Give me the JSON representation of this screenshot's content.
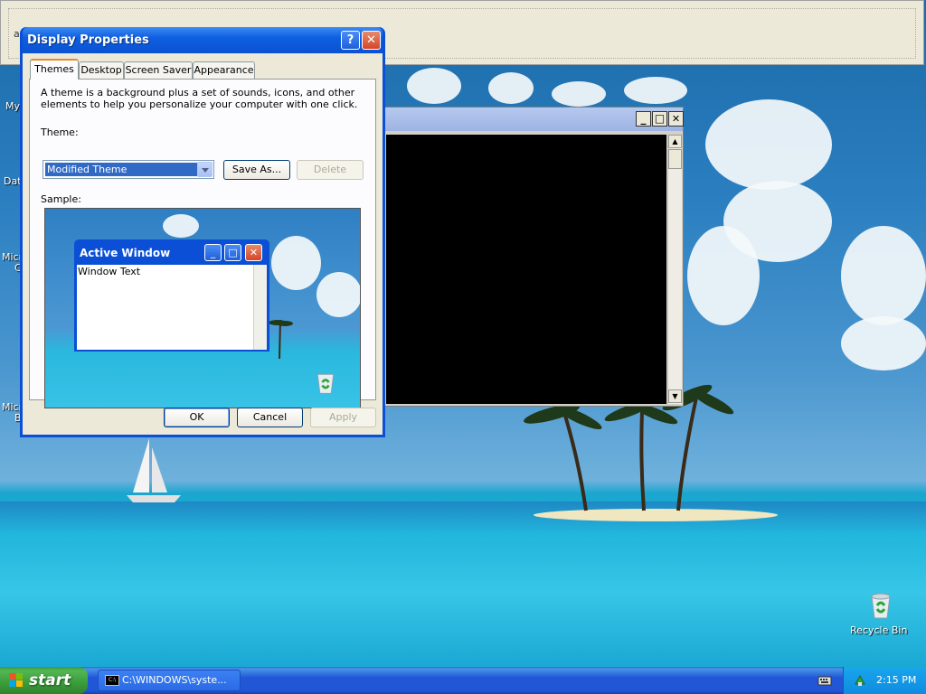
{
  "top_window": {
    "text": "a"
  },
  "desktop_icons": [
    "My",
    "Dat",
    "Micro",
    "C",
    "Micro",
    "B"
  ],
  "recycle_bin": {
    "label": "Recycle Bin"
  },
  "console": {
    "buttons": {
      "minimize": "_",
      "maximize": "□",
      "close": "✕"
    }
  },
  "dialog": {
    "title": "Display Properties",
    "tabs": [
      {
        "label": "Themes",
        "active": true
      },
      {
        "label": "Desktop",
        "active": false
      },
      {
        "label": "Screen Saver",
        "active": false
      },
      {
        "label": "Appearance",
        "active": false
      }
    ],
    "description": "A theme is a background plus a set of sounds, icons, and other elements to help you personalize your computer with one click.",
    "theme_label": "Theme:",
    "theme_value": "Modified Theme",
    "save_as": "Save As...",
    "delete": "Delete",
    "sample_label": "Sample:",
    "sample": {
      "window_title": "Active Window",
      "window_text": "Window Text"
    },
    "ok": "OK",
    "cancel": "Cancel",
    "apply": "Apply"
  },
  "taskbar": {
    "start_label": "start",
    "task_label": "C:\\WINDOWS\\syste...",
    "clock": "2:15 PM"
  }
}
